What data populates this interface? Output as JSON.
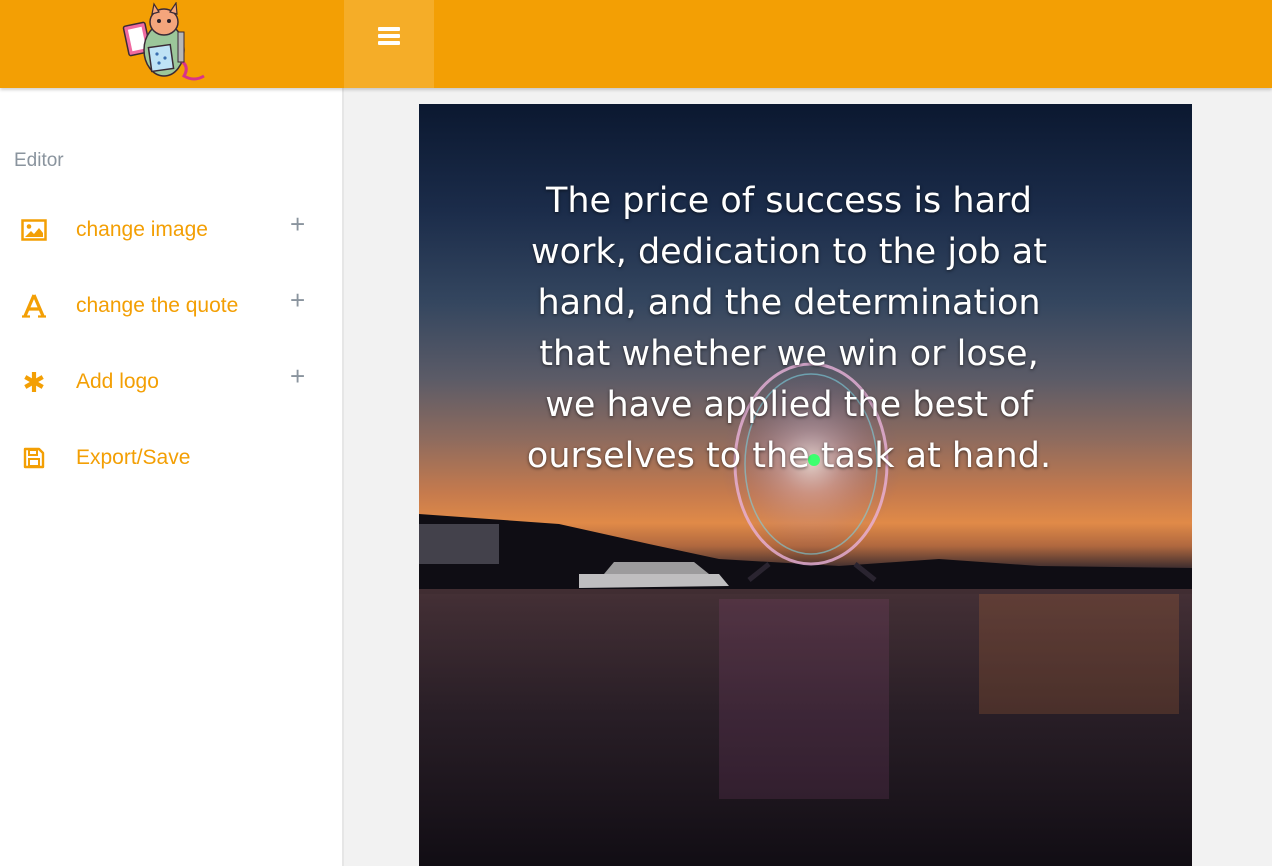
{
  "header": {
    "logo_icon": "monster-mascot-logo",
    "menu_icon": "hamburger-menu-icon"
  },
  "sidebar": {
    "heading": "Editor",
    "items": [
      {
        "label": "change image",
        "icon": "image-icon",
        "expandable": true
      },
      {
        "label": "change the quote",
        "icon": "font-letter-a-icon",
        "expandable": true
      },
      {
        "label": "Add logo",
        "icon": "asterisk-icon",
        "expandable": true
      },
      {
        "label": "Export/Save",
        "icon": "floppy-disk-icon",
        "expandable": false
      }
    ],
    "plus_symbol": "+"
  },
  "canvas": {
    "background_image": "ferris wheel at harbor during sunset",
    "quote_lines": [
      "The price of success is hard",
      "work, dedication to the job at",
      "hand, and the determination",
      "that whether we win or lose,",
      "we have applied the best of",
      "ourselves to the task at hand."
    ]
  },
  "colors": {
    "accent": "#f39f04",
    "accent_light": "#f5ad28",
    "muted": "#8a949e",
    "sidebar_bg": "#ffffff",
    "page_bg": "#f2f2f2"
  }
}
